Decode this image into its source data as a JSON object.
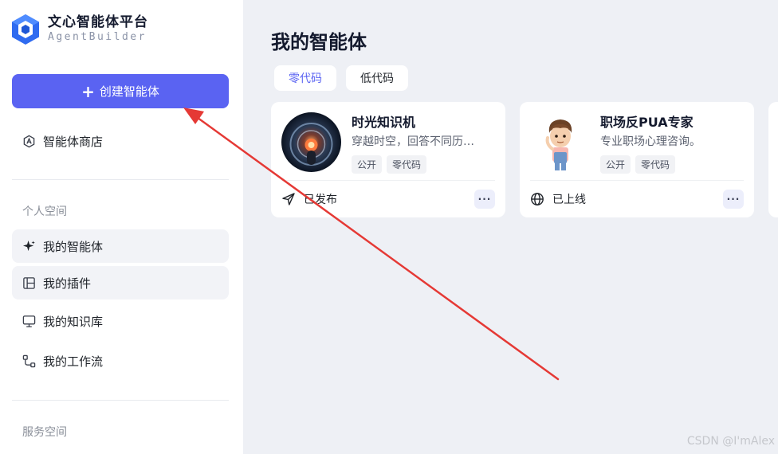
{
  "brand": {
    "title": "文心智能体平台",
    "subtitle": "AgentBuilder"
  },
  "sidebar": {
    "create_label": "创建智能体",
    "store_label": "智能体商店",
    "section_personal": "个人空间",
    "items": [
      {
        "label": "我的智能体",
        "icon": "sparkle-icon"
      },
      {
        "label": "我的插件",
        "icon": "plugin-icon"
      },
      {
        "label": "我的知识库",
        "icon": "monitor-icon"
      },
      {
        "label": "我的工作流",
        "icon": "workflow-icon"
      }
    ],
    "section_service": "服务空间"
  },
  "main": {
    "title": "我的智能体",
    "tabs": [
      {
        "label": "零代码",
        "active": true
      },
      {
        "label": "低代码",
        "active": false
      }
    ],
    "cards": [
      {
        "name": "时光知识机",
        "desc": "穿越时空，回答不同历…",
        "tags": [
          "公开",
          "零代码"
        ],
        "status": "已发布",
        "status_icon": "send-icon",
        "more": "···"
      },
      {
        "name": "职场反PUA专家",
        "desc": "专业职场心理咨询。",
        "tags": [
          "公开",
          "零代码"
        ],
        "status": "已上线",
        "status_icon": "globe-icon",
        "more": "···"
      }
    ]
  },
  "colors": {
    "accent": "#5a63f2",
    "arrow": "#e53935",
    "background": "#eef0f5"
  },
  "watermark": "CSDN @I'mAlex"
}
